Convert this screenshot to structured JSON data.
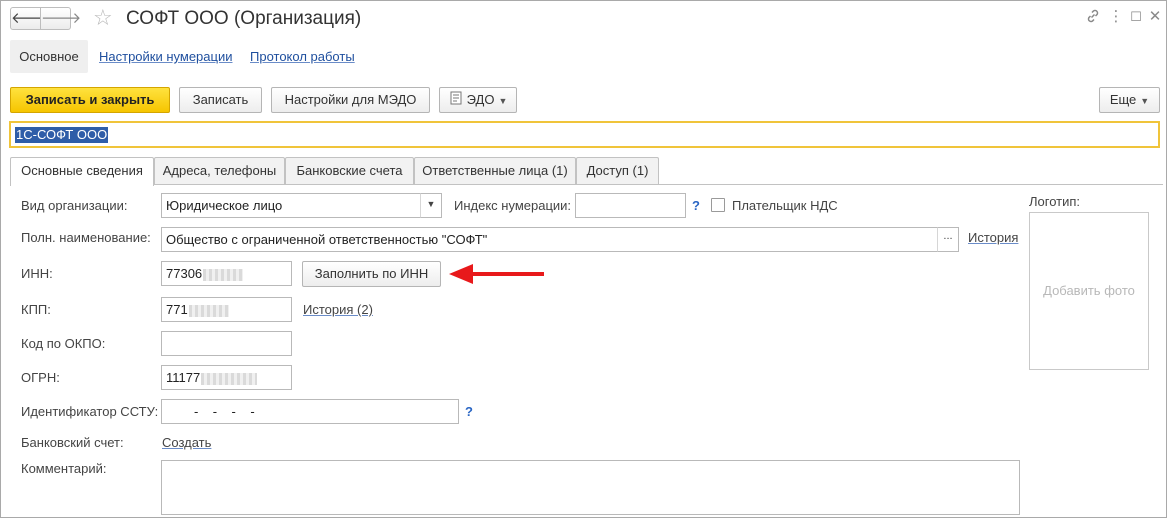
{
  "window": {
    "title": "СОФТ ООО (Организация)",
    "back_icon": "arrow-left-icon",
    "forward_icon": "arrow-right-icon",
    "favorite_icon": "star-icon",
    "link_symbol": "🔗",
    "menu_symbol": "⋮",
    "maximize_symbol": "☐",
    "close_symbol": "✕"
  },
  "sections": {
    "main": "Основное",
    "numbering": "Настройки нумерации",
    "log": "Протокол работы"
  },
  "toolbar": {
    "save_close": "Записать и закрыть",
    "save": "Записать",
    "medo": "Настройки для МЭДО",
    "edo": "ЭДО",
    "more": "Еще"
  },
  "name_field": {
    "value": "1С-СОФТ ООО"
  },
  "tabs": [
    {
      "label": "Основные сведения",
      "active": true
    },
    {
      "label": "Адреса, телефоны",
      "active": false
    },
    {
      "label": "Банковские счета",
      "active": false
    },
    {
      "label": "Ответственные лица (1)",
      "active": false
    },
    {
      "label": "Доступ (1)",
      "active": false
    }
  ],
  "form": {
    "org_type_label": "Вид организации:",
    "org_type_value": "Юридическое лицо",
    "numbering_index_label": "Индекс нумерации:",
    "numbering_index_value": "",
    "help_mark": "?",
    "vat_payer_label": "Плательщик НДС",
    "vat_payer_checked": false,
    "full_name_label": "Полн. наименование:",
    "full_name_value": "Общество с ограниченной ответственностью \"СОФТ\"",
    "ellipsis": "...",
    "history_link": "История",
    "inn_label": "ИНН:",
    "inn_value": "77306",
    "fill_by_inn": "Заполнить по ИНН",
    "kpp_label": "КПП:",
    "kpp_value": "771",
    "kpp_history_link": "История (2)",
    "okpo_label": "Код по ОКПО:",
    "okpo_value": "",
    "ogrn_label": "ОГРН:",
    "ogrn_value": "11177",
    "sstu_label": "Идентификатор ССТУ:",
    "sstu_value": "-    -    -    -",
    "bank_account_label": "Банковский счет:",
    "bank_account_create": "Создать",
    "comment_label": "Комментарий:",
    "comment_value": ""
  },
  "logo": {
    "label": "Логотип:",
    "add_photo": "Добавить фото"
  },
  "annotation": {
    "arrow_color": "#e8191b",
    "points_to": "Заполнить по ИНН"
  },
  "colors": {
    "accent_yellow": "#f6c500",
    "selection_blue": "#2f5da8",
    "link_blue": "#1f4f9e",
    "focus_border": "#f0c43a"
  }
}
